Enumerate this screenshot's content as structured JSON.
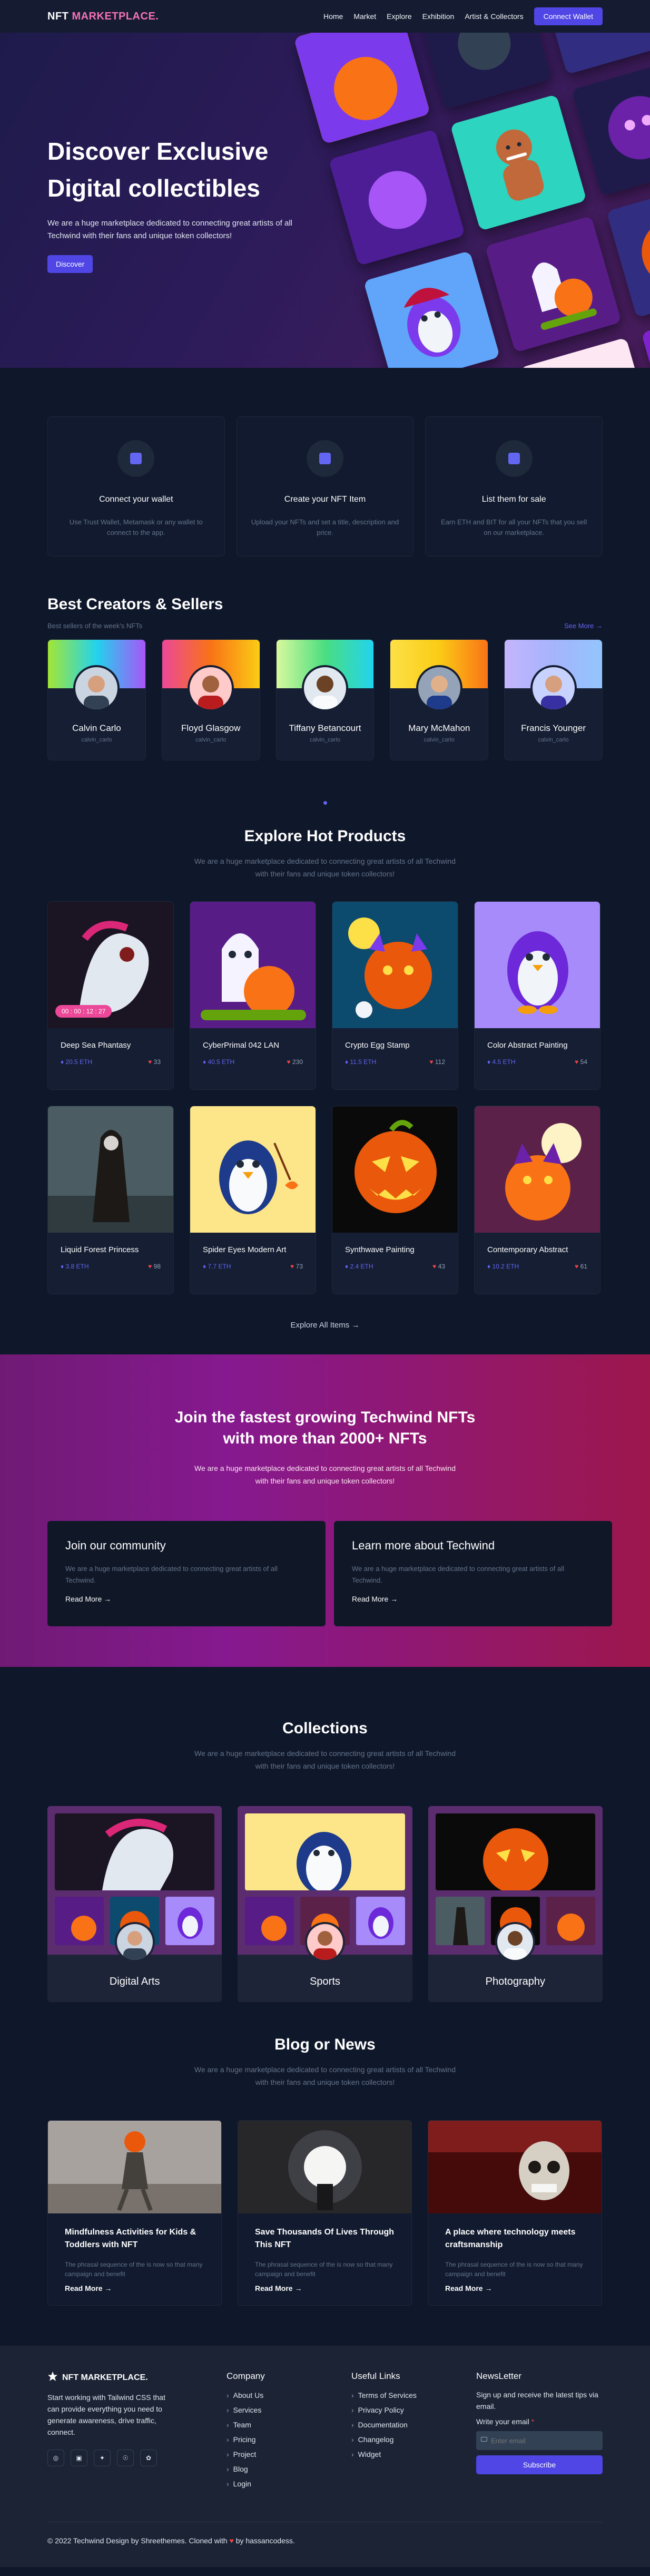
{
  "nav": {
    "brand_1": "NFT",
    "brand_2": "MARKETPLACE.",
    "links": [
      "Home",
      "Market",
      "Explore",
      "Exhibition",
      "Artist & Collectors"
    ],
    "cta": "Connect Wallet"
  },
  "hero": {
    "title_1": "Discover Exclusive",
    "title_2": "Digital collectibles",
    "subtitle": "We are a huge marketplace dedicated to connecting great artists of all Techwind with their fans and unique token collectors!",
    "button": "Discover"
  },
  "features": [
    {
      "title": "Connect your wallet",
      "text": "Use Trust Wallet, Metamask or any wallet to connect to the app."
    },
    {
      "title": "Create your NFT Item",
      "text": "Upload your NFTs and set a title, description and price."
    },
    {
      "title": "List them for sale",
      "text": "Earn ETH and BIT for all your NFTs that you sell on our marketplace."
    }
  ],
  "creators": {
    "title": "Best Creators & Sellers",
    "subtitle": "Best sellers of the week's NFTs",
    "see_more": "See More",
    "items": [
      {
        "name": "Calvin Carlo",
        "handle": "calvin_carlo"
      },
      {
        "name": "Floyd Glasgow",
        "handle": "calvin_carlo"
      },
      {
        "name": "Tiffany Betancourt",
        "handle": "calvin_carlo"
      },
      {
        "name": "Mary McMahon",
        "handle": "calvin_carlo"
      },
      {
        "name": "Francis Younger",
        "handle": "calvin_carlo"
      }
    ]
  },
  "products": {
    "title": "Explore Hot Products",
    "subtitle": "We are a huge marketplace dedicated to connecting great artists of all Techwind with their fans and unique token collectors!",
    "timer": "00 : 00 : 12 : 27",
    "items": [
      {
        "title": "Deep Sea Phantasy",
        "price": "20.5 ETH",
        "likes": "33"
      },
      {
        "title": "CyberPrimal 042 LAN",
        "price": "40.5 ETH",
        "likes": "230"
      },
      {
        "title": "Crypto Egg Stamp",
        "price": "11.5 ETH",
        "likes": "112"
      },
      {
        "title": "Color Abstract Painting",
        "price": "4.5 ETH",
        "likes": "54"
      },
      {
        "title": "Liquid Forest Princess",
        "price": "3.8 ETH",
        "likes": "98"
      },
      {
        "title": "Spider Eyes Modern Art",
        "price": "7.7 ETH",
        "likes": "73"
      },
      {
        "title": "Synthwave Painting",
        "price": "2.4 ETH",
        "likes": "43"
      },
      {
        "title": "Contemporary Abstract",
        "price": "10.2 ETH",
        "likes": "61"
      }
    ],
    "explore_all": "Explore All Items"
  },
  "join": {
    "title_1": "Join the fastest growing Techwind NFTs",
    "title_2": "with more than 2000+ NFTs",
    "subtitle": "We are a huge marketplace dedicated to connecting great artists of all Techwind with their fans and unique token collectors!",
    "cards": [
      {
        "title": "Join our community",
        "text": "We are a huge marketplace dedicated to connecting great artists of all Techwind.",
        "link": "Read More"
      },
      {
        "title": "Learn more about Techwind",
        "text": "We are a huge marketplace dedicated to connecting great artists of all Techwind.",
        "link": "Read More"
      }
    ]
  },
  "collections": {
    "title": "Collections",
    "subtitle": "We are a huge marketplace dedicated to connecting great artists of all Techwind with their fans and unique token collectors!",
    "items": [
      "Digital Arts",
      "Sports",
      "Photography"
    ]
  },
  "blog": {
    "title": "Blog or News",
    "subtitle": "We are a huge marketplace dedicated to connecting great artists of all Techwind with their fans and unique token collectors!",
    "items": [
      {
        "title": "Mindfulness Activities for Kids & Toddlers with NFT",
        "text": "The phrasal sequence of the is now so that many campaign and benefit",
        "link": "Read More"
      },
      {
        "title": "Save Thousands Of Lives Through This NFT",
        "text": "The phrasal sequence of the is now so that many campaign and benefit",
        "link": "Read More"
      },
      {
        "title": "A place where technology meets craftsmanship",
        "text": "The phrasal sequence of the is now so that many campaign and benefit",
        "link": "Read More"
      }
    ]
  },
  "footer": {
    "brand": "NFT MARKETPLACE.",
    "desc": "Start working with Tailwind CSS that can provide everything you need to generate awareness, drive traffic, connect.",
    "company_title": "Company",
    "company": [
      "About Us",
      "Services",
      "Team",
      "Pricing",
      "Project",
      "Blog",
      "Login"
    ],
    "links_title": "Useful Links",
    "links": [
      "Terms of Services",
      "Privacy Policy",
      "Documentation",
      "Changelog",
      "Widget"
    ],
    "news_title": "NewsLetter",
    "news_text": "Sign up and receive the latest tips via email.",
    "email_label": "Write your email",
    "email_placeholder": "Enter email",
    "subscribe": "Subscribe",
    "copyright_1": "© 2022 Techwind Design by Shreethemes. Cloned with",
    "copyright_2": "by hassancodess."
  },
  "colors": {
    "accent": "#4f46e5",
    "pink": "#ec4899",
    "background": "#0f172a"
  }
}
